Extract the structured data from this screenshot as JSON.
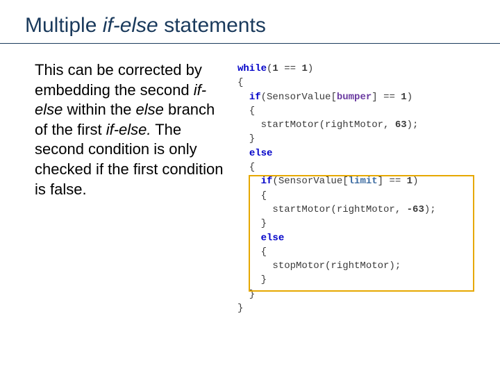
{
  "title": {
    "prefix": "Multiple ",
    "italic": "if-else",
    "suffix": " statements"
  },
  "body": {
    "t1": "This can be corrected by embedding the second ",
    "i1": "if-else",
    "t2": " within the ",
    "i2": "else",
    "t3": " branch of the first ",
    "i3": "if-else.",
    "t4": " The second condition is only checked if the first condition is false."
  },
  "code": {
    "l1a": "while",
    "l1b": "(",
    "l1c": "1",
    "l1d": " == ",
    "l1e": "1",
    "l1f": ")",
    "l2": "{",
    "l3a": "  ",
    "l3b": "if",
    "l3c": "(SensorValue[",
    "l3d": "bumper",
    "l3e": "] == ",
    "l3f": "1",
    "l3g": ")",
    "l4": "  {",
    "l5a": "    startMotor(rightMotor, ",
    "l5b": "63",
    "l5c": ");",
    "l6": "  }",
    "l7a": "  ",
    "l7b": "else",
    "l8": "  {",
    "l9a": "    ",
    "l9b": "if",
    "l9c": "(SensorValue[",
    "l9d": "limit",
    "l9e": "] == ",
    "l9f": "1",
    "l9g": ")",
    "l10": "    {",
    "l11a": "      startMotor(rightMotor, ",
    "l11b": "-63",
    "l11c": ");",
    "l12": "    }",
    "l13a": "    ",
    "l13b": "else",
    "l14": "    {",
    "l15": "      stopMotor(rightMotor);",
    "l16": "    }",
    "l17": "  }",
    "l18": "}"
  }
}
